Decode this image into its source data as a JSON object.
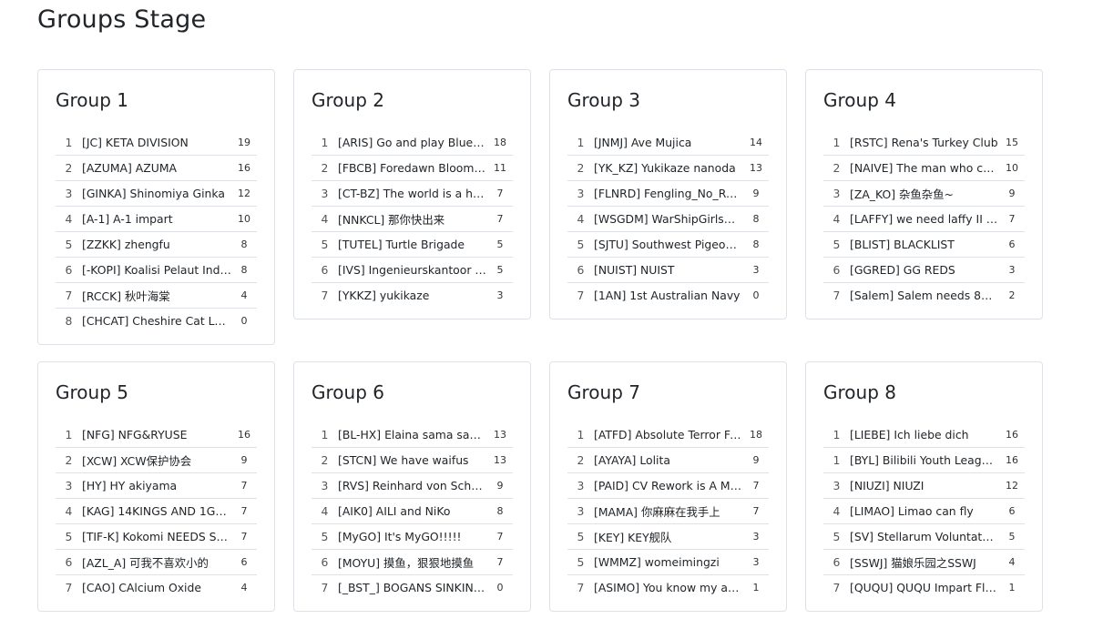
{
  "page_title": "Groups Stage",
  "groups": [
    {
      "title": "Group 1",
      "rows": [
        {
          "rank": "1",
          "team": "[JC] KETA DIVISION",
          "score": "19"
        },
        {
          "rank": "2",
          "team": "[AZUMA] AZUMA",
          "score": "16"
        },
        {
          "rank": "3",
          "team": "[GINKA] Shinomiya Ginka",
          "score": "12"
        },
        {
          "rank": "4",
          "team": "[A-1] A-1 impart",
          "score": "10"
        },
        {
          "rank": "5",
          "team": "[ZZKK] zhengfu",
          "score": "8"
        },
        {
          "rank": "6",
          "team": "[-KOPI] Koalisi Pelaut Indo…",
          "score": "8"
        },
        {
          "rank": "7",
          "team": "[RCCK] 秋叶海棠",
          "score": "4"
        },
        {
          "rank": "8",
          "team": "[CHCAT] Cheshire Cat Lov…",
          "score": "0"
        }
      ]
    },
    {
      "title": "Group 2",
      "rows": [
        {
          "rank": "1",
          "team": "[ARIS] Go and play Blue Ar…",
          "score": "18"
        },
        {
          "rank": "2",
          "team": "[FBCB] Foredawn Bloomin…",
          "score": "11"
        },
        {
          "rank": "3",
          "team": "[CT-BZ] The world is a hug…",
          "score": "7"
        },
        {
          "rank": "4",
          "team": "[NNKCL] 那你快出来",
          "score": "7"
        },
        {
          "rank": "5",
          "team": "[TUTEL] Turtle Brigade",
          "score": "5"
        },
        {
          "rank": "6",
          "team": "[IVS] Ingenieurskantoor v…",
          "score": "5"
        },
        {
          "rank": "7",
          "team": "[YKKZ] yukikaze",
          "score": "3"
        }
      ]
    },
    {
      "title": "Group 3",
      "rows": [
        {
          "rank": "1",
          "team": "[JNMJ] Ave Mujica",
          "score": "14"
        },
        {
          "rank": "2",
          "team": "[YK_KZ] Yukikaze nanoda",
          "score": "13"
        },
        {
          "rank": "3",
          "team": "[FLNRD] Fengling_No_Radar",
          "score": "9"
        },
        {
          "rank": "4",
          "team": "[WSGDM] WarShipGirlsDe…",
          "score": "8"
        },
        {
          "rank": "5",
          "team": "[SJTU] Southwest Pigeon …",
          "score": "8"
        },
        {
          "rank": "6",
          "team": "[NUIST] NUIST",
          "score": "3"
        },
        {
          "rank": "7",
          "team": "[1AN] 1st Australian Navy",
          "score": "0"
        }
      ]
    },
    {
      "title": "Group 4",
      "rows": [
        {
          "rank": "1",
          "team": "[RSTC] Rena's Turkey Club",
          "score": "15"
        },
        {
          "rank": "2",
          "team": "[NAIVE] The man who cha…",
          "score": "10"
        },
        {
          "rank": "3",
          "team": "[ZA_KO] 杂鱼杂鱼~",
          "score": "9"
        },
        {
          "rank": "4",
          "team": "[LAFFY] we need laffy II in …",
          "score": "7"
        },
        {
          "rank": "5",
          "team": "[BLIST] BLACKLIST",
          "score": "6"
        },
        {
          "rank": "6",
          "team": "[GGRED] GG REDS",
          "score": "3"
        },
        {
          "rank": "7",
          "team": "[Salem] Salem needs 80% …",
          "score": "2"
        }
      ]
    },
    {
      "title": "Group 5",
      "rows": [
        {
          "rank": "1",
          "team": "[NFG] NFG&RYUSE",
          "score": "16"
        },
        {
          "rank": "2",
          "team": "[XCW] XCW保护协会",
          "score": "9"
        },
        {
          "rank": "3",
          "team": "[HY] HY akiyama",
          "score": "7"
        },
        {
          "rank": "4",
          "team": "[KAG] 14KINGS AND 1GANG",
          "score": "7"
        },
        {
          "rank": "5",
          "team": "[TIF-K] Kokomi NEEDS Spo…",
          "score": "7"
        },
        {
          "rank": "6",
          "team": "[AZL_A] 可我不喜欢小的",
          "score": "6"
        },
        {
          "rank": "7",
          "team": "[CAO] CAlcium Oxide",
          "score": "4"
        }
      ]
    },
    {
      "title": "Group 6",
      "rows": [
        {
          "rank": "1",
          "team": "[BL-HX] Elaina sama saved…",
          "score": "13"
        },
        {
          "rank": "2",
          "team": "[STCN] We have waifus",
          "score": "13"
        },
        {
          "rank": "3",
          "team": "[RVS] Reinhard von Scheer",
          "score": "9"
        },
        {
          "rank": "4",
          "team": "[AIK0] AILI and NiKo",
          "score": "8"
        },
        {
          "rank": "5",
          "team": "[MyGO] It's MyGO!!!!!",
          "score": "7"
        },
        {
          "rank": "6",
          "team": "[MOYU] 摸鱼，狠狠地摸鱼",
          "score": "7"
        },
        {
          "rank": "7",
          "team": "[_BST_] BOGANS SINKIN T…",
          "score": "0"
        }
      ]
    },
    {
      "title": "Group 7",
      "rows": [
        {
          "rank": "1",
          "team": "[ATFD] Absolute Terror Field",
          "score": "18"
        },
        {
          "rank": "2",
          "team": "[AYAYA] Lolita",
          "score": "9"
        },
        {
          "rank": "3",
          "team": "[PAID] CV Rework is A Mist…",
          "score": "7"
        },
        {
          "rank": "3",
          "team": "[MAMA] 你麻麻在我手上",
          "score": "7"
        },
        {
          "rank": "5",
          "team": "[KEY] KEY舰队",
          "score": "3"
        },
        {
          "rank": "5",
          "team": "[WMMZ] womeimingzi",
          "score": "3"
        },
        {
          "rank": "7",
          "team": "[ASIMO] You know my ap…",
          "score": "1"
        }
      ]
    },
    {
      "title": "Group 8",
      "rows": [
        {
          "rank": "1",
          "team": "[LIEBE] Ich liebe dich",
          "score": "16"
        },
        {
          "rank": "1",
          "team": "[BYL] Bilibili Youth League…",
          "score": "16"
        },
        {
          "rank": "3",
          "team": "[NIUZI] NIUZI",
          "score": "12"
        },
        {
          "rank": "4",
          "team": "[LIMAO] Limao can fly",
          "score": "6"
        },
        {
          "rank": "5",
          "team": "[SV] Stellarum Voluntatem",
          "score": "5"
        },
        {
          "rank": "6",
          "team": "[SSWJ] 猫娘乐园之SSWJ",
          "score": "4"
        },
        {
          "rank": "7",
          "team": "[QUQU] QUQU Impart Fleet",
          "score": "1"
        }
      ]
    }
  ]
}
